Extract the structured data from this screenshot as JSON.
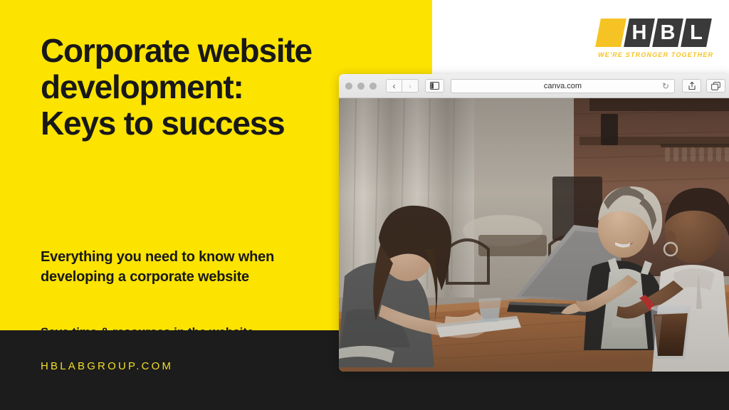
{
  "slide": {
    "headline": "Corporate website development: Keys to success",
    "subhead": "Everything you need to know when developing a corporate website",
    "clipped_line": "Save time & resources in the website development",
    "footer_url": "HBLABGROUP.COM",
    "colors": {
      "yellow": "#FCE300",
      "dark": "#1C1C1C",
      "text": "#181818",
      "footer_yellow": "#F2DE27",
      "logo_gold": "#F6C324",
      "logo_gray": "#3A3A3A"
    }
  },
  "logo": {
    "letters": [
      "H",
      "B",
      "L"
    ],
    "tagline": "WE'RE STRONGER TOGETHER"
  },
  "browser": {
    "traffic_lights": [
      "close-dot",
      "minimize-dot",
      "zoom-dot"
    ],
    "back_label": "‹",
    "forward_label": "›",
    "sidebar_icon": "sidebar-icon",
    "url": "canva.com",
    "reload_label": "↻",
    "share_icon": "share-icon",
    "tabs_icon": "tab-overview-icon"
  },
  "photo": {
    "alt": "Three women collaborating at a wooden table with a laptop in a cafe",
    "palette": {
      "wall": "#b9b3aa",
      "curtain": "#cfcac2",
      "brick": "#6d4a3a",
      "table": "#a96a3c",
      "laptop": "#9a9a9a",
      "apron": "#c9cbc4",
      "shirt_dark": "#4a4a4a",
      "drink": "#4b2a16"
    }
  }
}
